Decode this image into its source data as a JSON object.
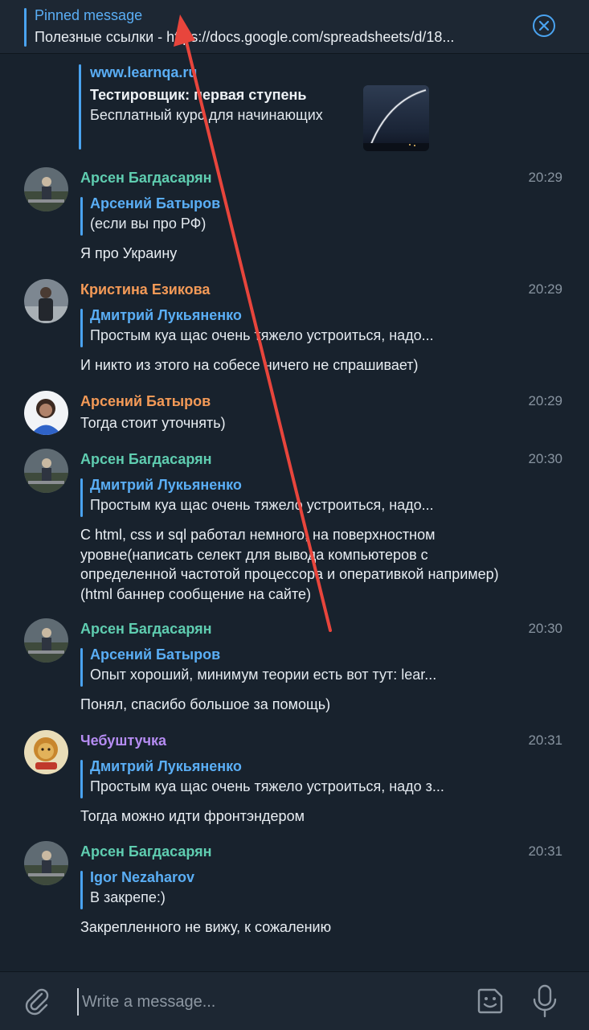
{
  "pinned": {
    "title": "Pinned message",
    "text": "Полезные ссылки - https://docs.google.com/spreadsheets/d/18..."
  },
  "link_preview": {
    "site": "www.learnqa.ru",
    "title": "Тестировщик: первая ступень",
    "description": "Бесплатный курс для начинающих"
  },
  "messages": [
    {
      "sender": "Арсен Багдасарян",
      "sender_color": "#5fcdb0",
      "time": "20:29",
      "reply_name": "Арсений Батыров",
      "reply_text": "(если вы про РФ)",
      "text": "Я про Украину"
    },
    {
      "sender": "Кристина Езикова",
      "sender_color": "#f49a57",
      "time": "20:29",
      "reply_name": "Дмитрий Лукьяненко",
      "reply_text": "Простым куа щас очень тяжело устроиться, надо...",
      "text": "И никто из этого на собесе ничего не спрашивает)"
    },
    {
      "sender": "Арсений Батыров",
      "sender_color": "#f49a57",
      "time": "20:29",
      "text": "Тогда стоит уточнять)"
    },
    {
      "sender": "Арсен Багдасарян",
      "sender_color": "#5fcdb0",
      "time": "20:30",
      "reply_name": "Дмитрий Лукьяненко",
      "reply_text": "Простым куа щас очень тяжело устроиться, надо...",
      "text": "С html, css и sql работал немного, на поверхностном уровне(написать селект для вывода компьютеров с определенной частотой процессора и оперативкой например) (html баннер сообщение на сайте)"
    },
    {
      "sender": "Арсен Багдасарян",
      "sender_color": "#5fcdb0",
      "time": "20:30",
      "reply_name": "Арсений Батыров",
      "reply_text": "Опыт хороший, минимум теории есть вот тут: lear...",
      "text": "Понял, спасибо большое за помощь)"
    },
    {
      "sender": "Чебуштучка",
      "sender_color": "#b58cf2",
      "time": "20:31",
      "reply_name": "Дмитрий Лукьяненко",
      "reply_text": "Простым куа щас очень тяжело устроиться, надо з...",
      "text": "Тогда можно идти фронтэндером"
    },
    {
      "sender": "Арсен Багдасарян",
      "sender_color": "#5fcdb0",
      "time": "20:31",
      "reply_name": "Igor Nezaharov",
      "reply_text": "В закрепе:)",
      "text": "Закрепленного не вижу, к сожалению"
    }
  ],
  "composer": {
    "placeholder": "Write a message..."
  },
  "colors": {
    "background": "#18222d",
    "accent": "#5aaef5",
    "annotation_arrow": "#e8453c"
  },
  "icons": [
    "close-circle-icon",
    "paperclip-icon",
    "sticker-icon",
    "microphone-icon"
  ]
}
